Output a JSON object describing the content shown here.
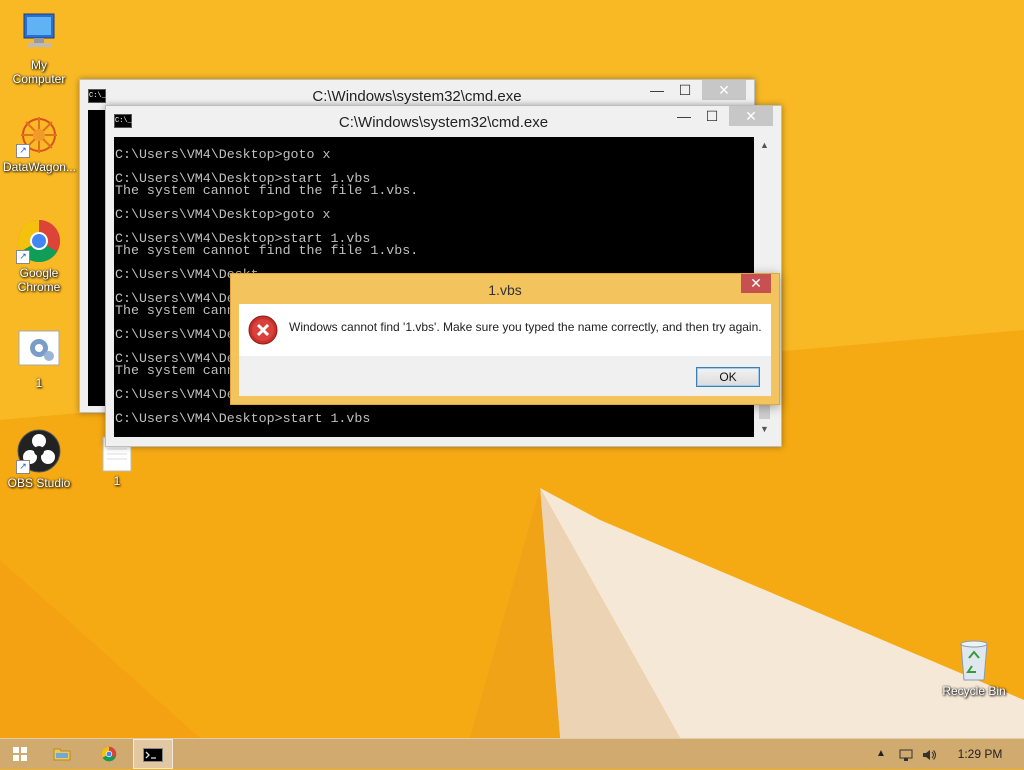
{
  "desktop": {
    "icons": [
      {
        "label": "My Computer"
      },
      {
        "label": "DataWagon..."
      },
      {
        "label": "Google\nChrome"
      },
      {
        "label": "1"
      },
      {
        "label": "OBS Studio"
      },
      {
        "label": "1"
      },
      {
        "label": "Recycle Bin"
      }
    ]
  },
  "cmd_back": {
    "title": "C:\\Windows\\system32\\cmd.exe",
    "visible_char": "C:",
    "minimize": "—",
    "maximize": "☐",
    "close": "✕"
  },
  "cmd_front": {
    "title": "C:\\Windows\\system32\\cmd.exe",
    "minimize": "—",
    "maximize": "☐",
    "close": "✕",
    "lines": [
      "C:\\Users\\VM4\\Desktop>goto x",
      "",
      "C:\\Users\\VM4\\Desktop>start 1.vbs",
      "The system cannot find the file 1.vbs.",
      "",
      "C:\\Users\\VM4\\Desktop>goto x",
      "",
      "C:\\Users\\VM4\\Desktop>start 1.vbs",
      "The system cannot find the file 1.vbs.",
      "",
      "C:\\Users\\VM4\\Deskt",
      "",
      "C:\\Users\\VM4\\Desk",
      "The system cann",
      "",
      "C:\\Users\\VM4\\Desk",
      "",
      "C:\\Users\\VM4\\Desk",
      "The system cann",
      "",
      "C:\\Users\\VM4\\Desk",
      "",
      "C:\\Users\\VM4\\Desktop>start 1.vbs"
    ]
  },
  "dialog": {
    "title": "1.vbs",
    "message": "Windows cannot find '1.vbs'. Make sure you typed the name correctly, and then try again.",
    "ok_label": "OK",
    "close": "✕"
  },
  "taskbar": {
    "clock": "1:29 PM"
  },
  "colors": {
    "wallpaper": "#f6b21a",
    "dialog_frame": "#f3c35e",
    "close_red": "#c75050"
  }
}
